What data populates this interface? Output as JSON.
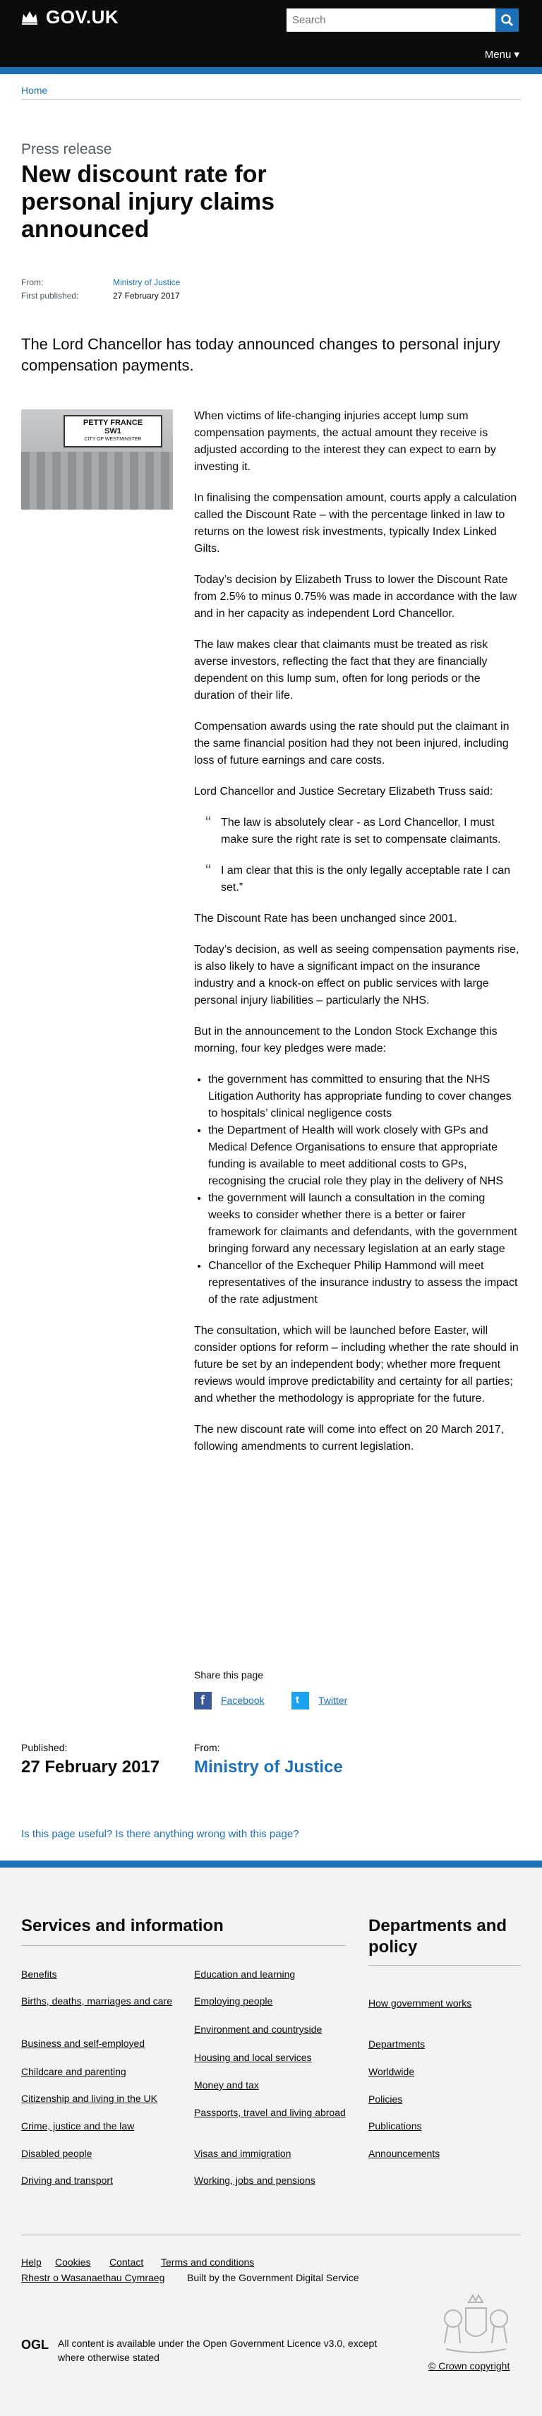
{
  "header": {
    "logo": "GOV.UK",
    "search_placeholder": "Search",
    "menu": "Menu"
  },
  "breadcrumb": {
    "home": "Home"
  },
  "article": {
    "document_type": "Press release",
    "title": "New discount rate for personal injury claims announced",
    "from_label": "From:",
    "from_value": "Ministry of Justice",
    "published_label": "First published:",
    "published_value": "27 February 2017",
    "summary": "The Lord Chancellor has today announced changes to personal injury compensation payments.",
    "image_sign_line1": "PETTY FRANCE",
    "image_sign_line2": "SW1",
    "image_sign_line3": "CITY OF WESTMINSTER",
    "paragraphs": [
      "When victims of life-changing injuries accept lump sum compensation payments, the actual amount they receive is adjusted according to the interest they can expect to earn by investing it.",
      "In finalising the compensation amount, courts apply a calculation called the Discount Rate – with the percentage linked in law to returns on the lowest risk investments, typically Index Linked Gilts.",
      "Today’s decision by Elizabeth Truss to lower the Discount Rate from 2.5% to minus 0.75% was made in accordance with the law and in her capacity as independent Lord Chancellor.",
      "The law makes clear that claimants must be treated as risk averse investors, reflecting the fact that they are financially dependent on this lump sum, often for long periods or the duration of their life.",
      "Compensation awards using the rate should put the claimant in the same financial position had they not been injured, including loss of future earnings and care costs.",
      "Lord Chancellor and Justice Secretary Elizabeth Truss said:"
    ],
    "quotes": [
      "The law is absolutely clear - as Lord Chancellor, I must make sure the right rate is set to compensate claimants.",
      "I am clear that this is the only legally acceptable rate I can set.”"
    ],
    "paragraphs2": [
      "The Discount Rate has been unchanged since 2001.",
      "Today’s decision, as well as seeing compensation payments rise, is also likely to have a significant impact on the insurance industry and a knock-on effect on public services with large personal injury liabilities – particularly the NHS.",
      "But in the announcement to the London Stock Exchange this morning, four key pledges were made:"
    ],
    "pledges": [
      "the government has committed to ensuring that the NHS Litigation Authority has appropriate funding to cover changes to hospitals’ clinical negligence costs",
      "the Department of Health will work closely with GPs and Medical Defence Organisations to ensure that appropriate funding is available to meet additional costs to GPs, recognising the crucial role they play in the delivery of NHS",
      "the government will launch a consultation in the coming weeks to consider whether there is a better or fairer framework for claimants and defendants, with the government bringing forward any necessary legislation at an early stage",
      "Chancellor of the Exchequer Philip Hammond will meet representatives of the insurance industry to assess the impact of the rate adjustment"
    ],
    "paragraphs3": [
      "The consultation, which will be launched before Easter, will consider options for reform – including whether the rate should in future be set by an independent body; whether more frequent reviews would improve predictability and certainty for all parties; and whether the methodology is appropriate for the future.",
      "The new discount rate will come into effect on 20 March 2017, following amendments to current legislation."
    ]
  },
  "share": {
    "title": "Share this page",
    "facebook": "Facebook",
    "twitter": "Twitter"
  },
  "published_footer": {
    "published_label": "Published:",
    "published_value": "27 February 2017",
    "from_label": "From:",
    "from_value": "Ministry of Justice"
  },
  "feedback": {
    "link": "Is this page useful? Is there anything wrong with this page?"
  },
  "footer": {
    "services_title": "Services and information",
    "services_col1": [
      "Benefits",
      "Births, deaths, marriages and care",
      "Business and self-employed",
      "Childcare and parenting",
      "Citizenship and living in the UK",
      "Crime, justice and the law",
      "Disabled people",
      "Driving and transport"
    ],
    "services_col2": [
      "Education and learning",
      "Employing people",
      "Environment and countryside",
      "Housing and local services",
      "Money and tax",
      "Passports, travel and living abroad",
      "Visas and immigration",
      "Working, jobs and pensions"
    ],
    "departments_title": "Departments and policy",
    "departments": [
      "How government works",
      "Departments",
      "Worldwide",
      "Policies",
      "Publications",
      "Announcements"
    ],
    "meta_links": [
      "Help",
      "Cookies",
      "Contact",
      "Terms and conditions"
    ],
    "meta_links2": [
      "Rhestr o Wasanaethau Cymraeg",
      "Built by the Government Digital Service"
    ],
    "ogl": "OGL",
    "licence_prefix": "All content is available under the",
    "licence_link": "Open Government Licence v3.0",
    "licence_suffix": ", except where otherwise stated",
    "copyright": "© Crown copyright"
  }
}
